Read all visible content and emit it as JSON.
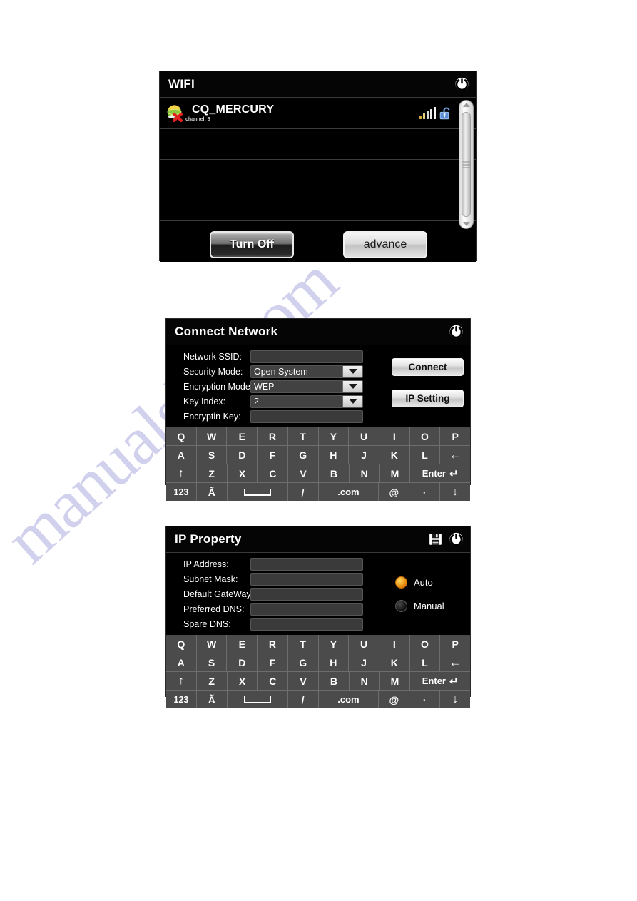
{
  "page": {
    "watermark": "manualslib.com"
  },
  "wifi_panel": {
    "title": "WIFI",
    "power_icon": "power-icon",
    "networks": [
      {
        "ssid": "CQ_MERCURY",
        "channel_label": "channel: 6",
        "signal_icon": "signal-bars-icon",
        "signal_bars": 5,
        "signal_bar_colors": [
          "#d8a93a",
          "#e8d27a",
          "#d9d9d9",
          "#ededed",
          "#f6f6f6"
        ],
        "security_icon": "unlocked-padlock-icon",
        "status_icon": "globe-disconnected-icon"
      }
    ],
    "empty_rows": 4,
    "scrollbar": {
      "up_icon": "scroll-up-arrow-icon",
      "down_icon": "scroll-down-arrow-icon",
      "grip_icon": "scrollbar-grip-icon"
    },
    "buttons": {
      "turn_off": "Turn Off",
      "advance": "advance"
    }
  },
  "connect_panel": {
    "title": "Connect Network",
    "power_icon": "power-icon",
    "fields": [
      {
        "label": "Network SSID:",
        "value": "",
        "type": "text"
      },
      {
        "label": "Security Mode:",
        "value": "Open System",
        "type": "dropdown"
      },
      {
        "label": "Encryption Mode:",
        "value": "WEP",
        "type": "dropdown"
      },
      {
        "label": "Key Index:",
        "value": "2",
        "type": "dropdown"
      },
      {
        "label": "Encryptin Key:",
        "value": "",
        "type": "text"
      }
    ],
    "buttons": {
      "connect": "Connect",
      "ip_setting": "IP Setting"
    }
  },
  "ip_panel": {
    "title": "IP Property",
    "save_icon": "floppy-save-icon",
    "power_icon": "power-icon",
    "fields": [
      {
        "label": "IP Address:",
        "value": ""
      },
      {
        "label": "Subnet Mask:",
        "value": ""
      },
      {
        "label": "Default GateWay:",
        "value": ""
      },
      {
        "label": "Preferred DNS:",
        "value": ""
      },
      {
        "label": "Spare DNS:",
        "value": ""
      }
    ],
    "mode_options": [
      {
        "label": "Auto",
        "selected": true
      },
      {
        "label": "Manual",
        "selected": false
      }
    ]
  },
  "keyboard": {
    "row1": [
      "Q",
      "W",
      "E",
      "R",
      "T",
      "Y",
      "U",
      "I",
      "O",
      "P"
    ],
    "row2": [
      "A",
      "S",
      "D",
      "F",
      "G",
      "H",
      "J",
      "K",
      "L"
    ],
    "row2_backspace": "←",
    "row3": [
      "Z",
      "X",
      "C",
      "V",
      "B",
      "N",
      "M"
    ],
    "row3_shift": "↑",
    "row3_enter": "Enter",
    "row3_enter_icon": "↵",
    "row4": {
      "numbers": "123",
      "accents": "Ã",
      "space": "space-bar-icon",
      "slash": "/",
      "dotcom": ".com",
      "at": "@",
      "dot": "·",
      "down": "↓"
    }
  },
  "colors": {
    "panel_bg": "#000000",
    "key_bg": "#4b4b4b",
    "field_bg": "#424242",
    "accent_radio": "#e07b00",
    "lock_blue": "#5b8fd4",
    "watermark": "#9a9ad8"
  }
}
